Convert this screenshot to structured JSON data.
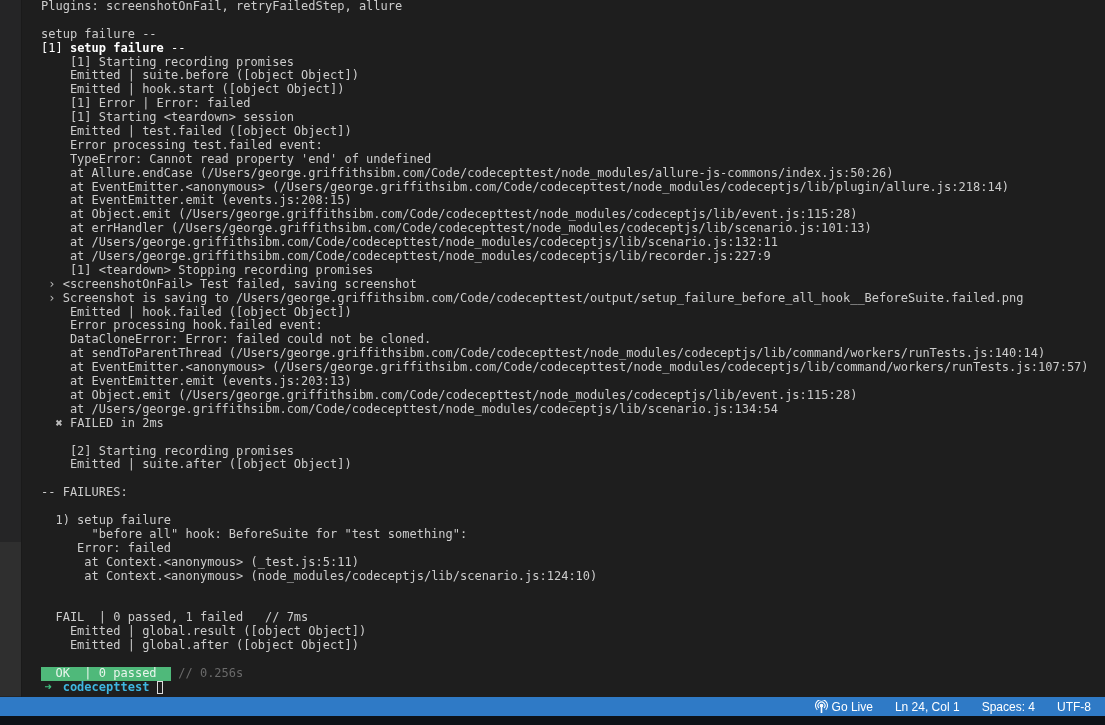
{
  "terminal": {
    "lines": [
      {
        "kind": "plain",
        "text": "Plugins: screenshotOnFail, retryFailedStep, allure"
      },
      {
        "kind": "blank"
      },
      {
        "kind": "plain",
        "text": "setup failure --"
      },
      {
        "kind": "title",
        "text": "[1] **setup failure** --"
      },
      {
        "kind": "plain",
        "text": "    [1] Starting recording promises"
      },
      {
        "kind": "plain",
        "text": "    Emitted | suite.before ([object Object])"
      },
      {
        "kind": "plain",
        "text": "    Emitted | hook.start ([object Object])"
      },
      {
        "kind": "plain",
        "text": "    [1] Error | Error: failed"
      },
      {
        "kind": "plain",
        "text": "    [1] Starting <teardown> session"
      },
      {
        "kind": "plain",
        "text": "    Emitted | test.failed ([object Object])"
      },
      {
        "kind": "plain",
        "text": "    Error processing test.failed event:"
      },
      {
        "kind": "plain",
        "text": "    TypeError: Cannot read property 'end' of undefined"
      },
      {
        "kind": "plain",
        "text": "    at Allure.endCase (/Users/george.griffithsibm.com/Code/codecepttest/node_modules/allure-js-commons/index.js:50:26)"
      },
      {
        "kind": "plain",
        "text": "    at EventEmitter.<anonymous> (/Users/george.griffithsibm.com/Code/codecepttest/node_modules/codeceptjs/lib/plugin/allure.js:218:14)"
      },
      {
        "kind": "plain",
        "text": "    at EventEmitter.emit (events.js:208:15)"
      },
      {
        "kind": "plain",
        "text": "    at Object.emit (/Users/george.griffithsibm.com/Code/codecepttest/node_modules/codeceptjs/lib/event.js:115:28)"
      },
      {
        "kind": "plain",
        "text": "    at errHandler (/Users/george.griffithsibm.com/Code/codecepttest/node_modules/codeceptjs/lib/scenario.js:101:13)"
      },
      {
        "kind": "plain",
        "text": "    at /Users/george.griffithsibm.com/Code/codecepttest/node_modules/codeceptjs/lib/scenario.js:132:11"
      },
      {
        "kind": "plain",
        "text": "    at /Users/george.griffithsibm.com/Code/codecepttest/node_modules/codeceptjs/lib/recorder.js:227:9"
      },
      {
        "kind": "plain",
        "text": "    [1] <teardown> Stopping recording promises"
      },
      {
        "kind": "marker",
        "marker": " ›",
        "text": "<screenshotOnFail> Test failed, saving screenshot"
      },
      {
        "kind": "marker",
        "marker": " ›",
        "text": "Screenshot is saving to /Users/george.griffithsibm.com/Code/codecepttest/output/setup_failure_before_all_hook__BeforeSuite.failed.png"
      },
      {
        "kind": "plain",
        "text": "    Emitted | hook.failed ([object Object])"
      },
      {
        "kind": "plain",
        "text": "    Error processing hook.failed event:"
      },
      {
        "kind": "plain",
        "text": "    DataCloneError: Error: failed could not be cloned."
      },
      {
        "kind": "plain",
        "text": "    at sendToParentThread (/Users/george.griffithsibm.com/Code/codecepttest/node_modules/codeceptjs/lib/command/workers/runTests.js:140:14)"
      },
      {
        "kind": "plain",
        "text": "    at EventEmitter.<anonymous> (/Users/george.griffithsibm.com/Code/codecepttest/node_modules/codeceptjs/lib/command/workers/runTests.js:107:57)"
      },
      {
        "kind": "plain",
        "text": "    at EventEmitter.emit (events.js:203:13)"
      },
      {
        "kind": "plain",
        "text": "    at Object.emit (/Users/george.griffithsibm.com/Code/codecepttest/node_modules/codeceptjs/lib/event.js:115:28)"
      },
      {
        "kind": "plain",
        "text": "    at /Users/george.griffithsibm.com/Code/codecepttest/node_modules/codeceptjs/lib/scenario.js:134:54"
      },
      {
        "kind": "marker",
        "marker": "  ✖",
        "text": "FAILED in 2ms"
      },
      {
        "kind": "blank"
      },
      {
        "kind": "plain",
        "text": "    [2] Starting recording promises"
      },
      {
        "kind": "plain",
        "text": "    Emitted | suite.after ([object Object])"
      },
      {
        "kind": "blank"
      },
      {
        "kind": "plain",
        "text": "-- FAILURES:"
      },
      {
        "kind": "blank"
      },
      {
        "kind": "plain",
        "text": "  1) setup failure"
      },
      {
        "kind": "plain",
        "text": "       \"before all\" hook: BeforeSuite for \"test something\":"
      },
      {
        "kind": "plain",
        "text": "     Error: failed"
      },
      {
        "kind": "plain",
        "text": "      at Context.<anonymous> (_test.js:5:11)"
      },
      {
        "kind": "plain",
        "text": "      at Context.<anonymous> (node_modules/codeceptjs/lib/scenario.js:124:10)"
      },
      {
        "kind": "blank"
      },
      {
        "kind": "blank"
      },
      {
        "kind": "plain",
        "text": "  FAIL  | 0 passed, 1 failed   // 7ms"
      },
      {
        "kind": "plain",
        "text": "    Emitted | global.result ([object Object])"
      },
      {
        "kind": "plain",
        "text": "    Emitted | global.after ([object Object])"
      },
      {
        "kind": "blank"
      },
      {
        "kind": "summary",
        "badge": "OK  | 0 passed",
        "text": "// 0.256s"
      },
      {
        "kind": "prompt",
        "marker": "➜",
        "text": "codecepttest"
      }
    ]
  },
  "status_bar": {
    "items": [
      {
        "kind": "live",
        "text": "Go Live"
      },
      {
        "kind": "plain",
        "text": "Ln 24, Col 1"
      },
      {
        "kind": "plain",
        "text": "Spaces: 4"
      },
      {
        "kind": "plain",
        "text": "UTF-8"
      }
    ]
  }
}
